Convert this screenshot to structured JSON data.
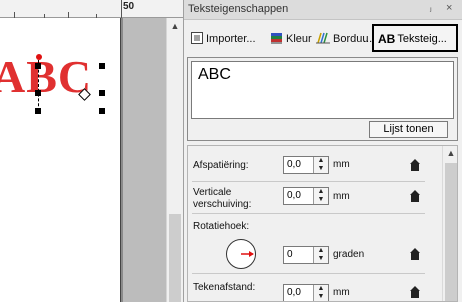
{
  "ruler": {
    "label": "50"
  },
  "canvas": {
    "design_text": "ABC",
    "text_color": "#e03030"
  },
  "panel": {
    "title": "Teksteigenschappen",
    "pin_glyph": "ⱼ",
    "close_glyph": "×",
    "toolbar": {
      "import_label": "Importer...",
      "color_label": "Kleur",
      "embroidery_label": "Borduu",
      "overflow_label": "...",
      "active_tab_prefix": "AB",
      "active_tab_label": "Teksteig..."
    },
    "text_input": {
      "value": "ABC"
    },
    "list_button_label": "Lijst tonen",
    "properties": {
      "spacing": {
        "label": "Afspatiëring:",
        "value": "0,0",
        "unit": "mm"
      },
      "vertical_shift": {
        "label_line1": "Verticale",
        "label_line2": "verschuiving:",
        "value": "0,0",
        "unit": "mm"
      },
      "rotation": {
        "label": "Rotatiehoek:",
        "value": "0",
        "unit": "graden"
      },
      "char_spacing": {
        "label": "Tekenafstand:",
        "value": "0,0",
        "unit": "mm"
      }
    }
  },
  "icons": {
    "import": "import-icon",
    "color": "color-icon",
    "embroidery": "embroidery-icon",
    "home": "home-icon",
    "scroll_up": "scroll-up-arrow-icon"
  }
}
